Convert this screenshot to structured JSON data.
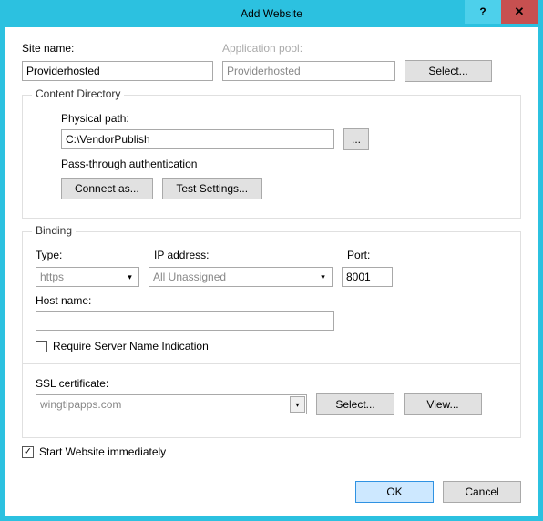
{
  "window": {
    "title": "Add Website"
  },
  "site": {
    "name_label": "Site name:",
    "name_value": "Providerhosted",
    "pool_label": "Application pool:",
    "pool_value": "Providerhosted",
    "select_label": "Select..."
  },
  "content_dir": {
    "legend": "Content Directory",
    "path_label": "Physical path:",
    "path_value": "C:\\VendorPublish",
    "browse_label": "...",
    "passthrough_label": "Pass-through authentication",
    "connect_as_label": "Connect as...",
    "test_label": "Test Settings..."
  },
  "binding": {
    "legend": "Binding",
    "type_label": "Type:",
    "type_value": "https",
    "ip_label": "IP address:",
    "ip_value": "All Unassigned",
    "port_label": "Port:",
    "port_value": "8001",
    "host_label": "Host name:",
    "host_value": "",
    "sni_label": "Require Server Name Indication",
    "sni_checked": false,
    "ssl_label": "SSL certificate:",
    "ssl_value": "wingtipapps.com",
    "ssl_select_label": "Select...",
    "ssl_view_label": "View..."
  },
  "start_immediately": {
    "label": "Start Website immediately",
    "checked": true,
    "checkmark": "✓"
  },
  "footer": {
    "ok_label": "OK",
    "cancel_label": "Cancel"
  },
  "glyphs": {
    "help": "?",
    "close": "✕",
    "dropdown": "▾"
  }
}
